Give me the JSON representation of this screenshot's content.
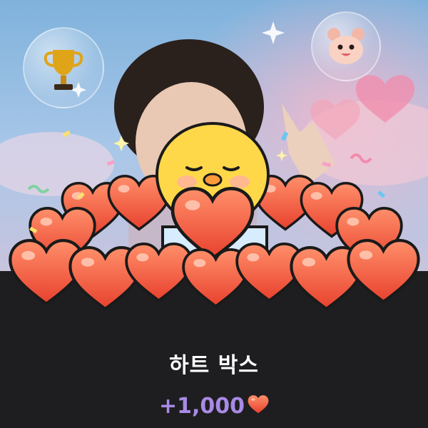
{
  "reward": {
    "title": "하트 박스",
    "amount": "+1,000",
    "currency_icon": "heart-icon"
  },
  "decor": {
    "left_bubble_icon": "trophy-icon",
    "right_bubble_icon": "bear-face-icon"
  },
  "colors": {
    "panel_bg": "#1e1e20",
    "amount_text": "#a98ae6",
    "heart_fill": "#f25a3c",
    "heart_light": "#ffa17b",
    "mascot_yellow": "#ffd84a"
  }
}
